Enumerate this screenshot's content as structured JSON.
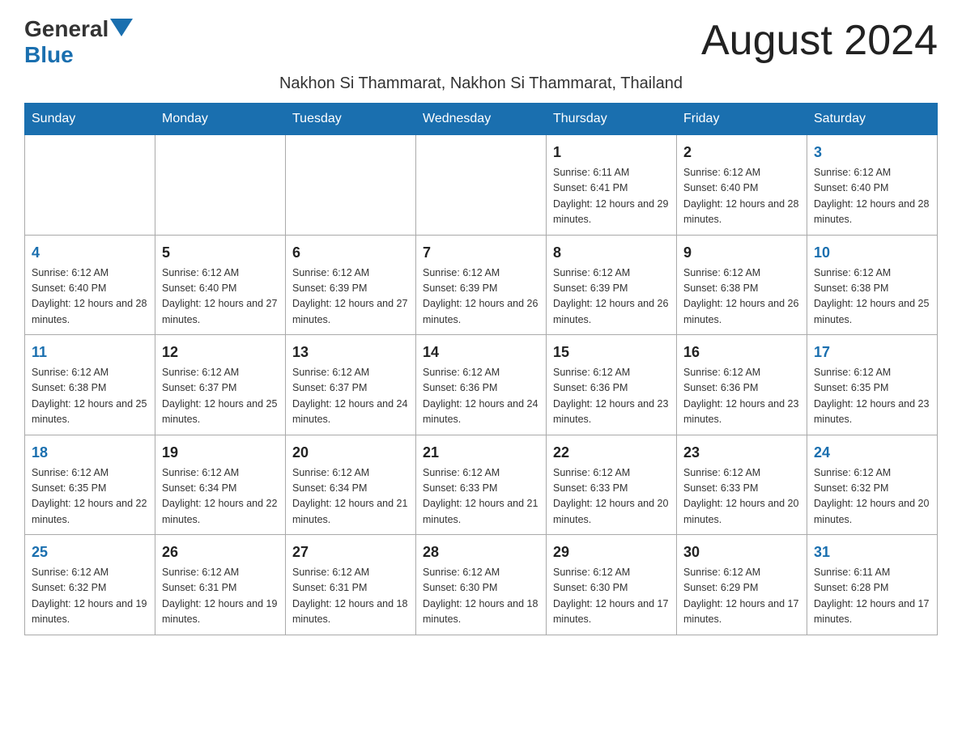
{
  "header": {
    "logo_general": "General",
    "logo_blue": "Blue",
    "month_title": "August 2024",
    "location": "Nakhon Si Thammarat, Nakhon Si Thammarat, Thailand"
  },
  "days_of_week": [
    "Sunday",
    "Monday",
    "Tuesday",
    "Wednesday",
    "Thursday",
    "Friday",
    "Saturday"
  ],
  "weeks": [
    [
      {
        "day": "",
        "info": ""
      },
      {
        "day": "",
        "info": ""
      },
      {
        "day": "",
        "info": ""
      },
      {
        "day": "",
        "info": ""
      },
      {
        "day": "1",
        "info": "Sunrise: 6:11 AM\nSunset: 6:41 PM\nDaylight: 12 hours and 29 minutes."
      },
      {
        "day": "2",
        "info": "Sunrise: 6:12 AM\nSunset: 6:40 PM\nDaylight: 12 hours and 28 minutes."
      },
      {
        "day": "3",
        "info": "Sunrise: 6:12 AM\nSunset: 6:40 PM\nDaylight: 12 hours and 28 minutes."
      }
    ],
    [
      {
        "day": "4",
        "info": "Sunrise: 6:12 AM\nSunset: 6:40 PM\nDaylight: 12 hours and 28 minutes."
      },
      {
        "day": "5",
        "info": "Sunrise: 6:12 AM\nSunset: 6:40 PM\nDaylight: 12 hours and 27 minutes."
      },
      {
        "day": "6",
        "info": "Sunrise: 6:12 AM\nSunset: 6:39 PM\nDaylight: 12 hours and 27 minutes."
      },
      {
        "day": "7",
        "info": "Sunrise: 6:12 AM\nSunset: 6:39 PM\nDaylight: 12 hours and 26 minutes."
      },
      {
        "day": "8",
        "info": "Sunrise: 6:12 AM\nSunset: 6:39 PM\nDaylight: 12 hours and 26 minutes."
      },
      {
        "day": "9",
        "info": "Sunrise: 6:12 AM\nSunset: 6:38 PM\nDaylight: 12 hours and 26 minutes."
      },
      {
        "day": "10",
        "info": "Sunrise: 6:12 AM\nSunset: 6:38 PM\nDaylight: 12 hours and 25 minutes."
      }
    ],
    [
      {
        "day": "11",
        "info": "Sunrise: 6:12 AM\nSunset: 6:38 PM\nDaylight: 12 hours and 25 minutes."
      },
      {
        "day": "12",
        "info": "Sunrise: 6:12 AM\nSunset: 6:37 PM\nDaylight: 12 hours and 25 minutes."
      },
      {
        "day": "13",
        "info": "Sunrise: 6:12 AM\nSunset: 6:37 PM\nDaylight: 12 hours and 24 minutes."
      },
      {
        "day": "14",
        "info": "Sunrise: 6:12 AM\nSunset: 6:36 PM\nDaylight: 12 hours and 24 minutes."
      },
      {
        "day": "15",
        "info": "Sunrise: 6:12 AM\nSunset: 6:36 PM\nDaylight: 12 hours and 23 minutes."
      },
      {
        "day": "16",
        "info": "Sunrise: 6:12 AM\nSunset: 6:36 PM\nDaylight: 12 hours and 23 minutes."
      },
      {
        "day": "17",
        "info": "Sunrise: 6:12 AM\nSunset: 6:35 PM\nDaylight: 12 hours and 23 minutes."
      }
    ],
    [
      {
        "day": "18",
        "info": "Sunrise: 6:12 AM\nSunset: 6:35 PM\nDaylight: 12 hours and 22 minutes."
      },
      {
        "day": "19",
        "info": "Sunrise: 6:12 AM\nSunset: 6:34 PM\nDaylight: 12 hours and 22 minutes."
      },
      {
        "day": "20",
        "info": "Sunrise: 6:12 AM\nSunset: 6:34 PM\nDaylight: 12 hours and 21 minutes."
      },
      {
        "day": "21",
        "info": "Sunrise: 6:12 AM\nSunset: 6:33 PM\nDaylight: 12 hours and 21 minutes."
      },
      {
        "day": "22",
        "info": "Sunrise: 6:12 AM\nSunset: 6:33 PM\nDaylight: 12 hours and 20 minutes."
      },
      {
        "day": "23",
        "info": "Sunrise: 6:12 AM\nSunset: 6:33 PM\nDaylight: 12 hours and 20 minutes."
      },
      {
        "day": "24",
        "info": "Sunrise: 6:12 AM\nSunset: 6:32 PM\nDaylight: 12 hours and 20 minutes."
      }
    ],
    [
      {
        "day": "25",
        "info": "Sunrise: 6:12 AM\nSunset: 6:32 PM\nDaylight: 12 hours and 19 minutes."
      },
      {
        "day": "26",
        "info": "Sunrise: 6:12 AM\nSunset: 6:31 PM\nDaylight: 12 hours and 19 minutes."
      },
      {
        "day": "27",
        "info": "Sunrise: 6:12 AM\nSunset: 6:31 PM\nDaylight: 12 hours and 18 minutes."
      },
      {
        "day": "28",
        "info": "Sunrise: 6:12 AM\nSunset: 6:30 PM\nDaylight: 12 hours and 18 minutes."
      },
      {
        "day": "29",
        "info": "Sunrise: 6:12 AM\nSunset: 6:30 PM\nDaylight: 12 hours and 17 minutes."
      },
      {
        "day": "30",
        "info": "Sunrise: 6:12 AM\nSunset: 6:29 PM\nDaylight: 12 hours and 17 minutes."
      },
      {
        "day": "31",
        "info": "Sunrise: 6:11 AM\nSunset: 6:28 PM\nDaylight: 12 hours and 17 minutes."
      }
    ]
  ]
}
